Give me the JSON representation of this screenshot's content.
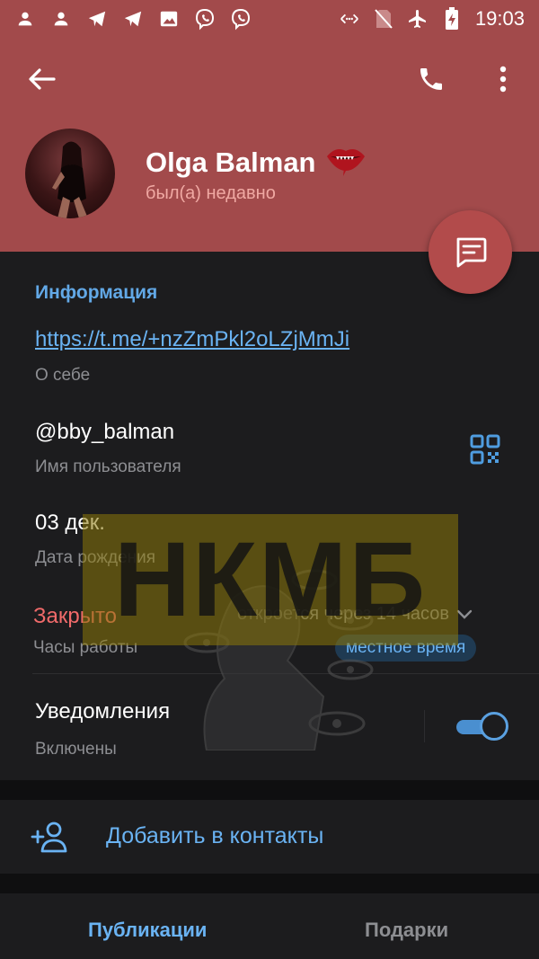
{
  "status_bar": {
    "time": "19:03",
    "left_icons": [
      "person-icon",
      "person-icon",
      "telegram-icon",
      "telegram-icon",
      "image-icon",
      "viber-icon",
      "viber-icon"
    ],
    "right_icons": [
      "data-saver-icon",
      "no-sim-icon",
      "airplane-icon",
      "battery-charging-icon"
    ]
  },
  "profile": {
    "name": "Olga Balman",
    "emoji": "lips-icon",
    "status": "был(а) недавно"
  },
  "info": {
    "title": "Информация",
    "link": "https://t.me/+nzZmPkl2oLZjMmJi",
    "link_sub": "О себе",
    "username": "@bby_balman",
    "username_sub": "Имя пользователя",
    "birthday": "03 дек.",
    "birthday_sub": "Дата рождения",
    "hours_status": "Закрыто",
    "hours_opens": "откроется через 14 часов",
    "hours_sub": "Часы работы",
    "local_time_label": "местное время",
    "notifications": "Уведомления",
    "notifications_sub": "Включены",
    "notifications_on": true
  },
  "watermark": "НКМБ",
  "actions": {
    "add_contact": "Добавить в контакты"
  },
  "tabs": {
    "active": "Публикации",
    "inactive": "Подарки"
  },
  "colors": {
    "header": "#a24a4b",
    "accent": "#6ab3f3",
    "background": "#1c1c1e",
    "closed": "#f06a6a"
  }
}
